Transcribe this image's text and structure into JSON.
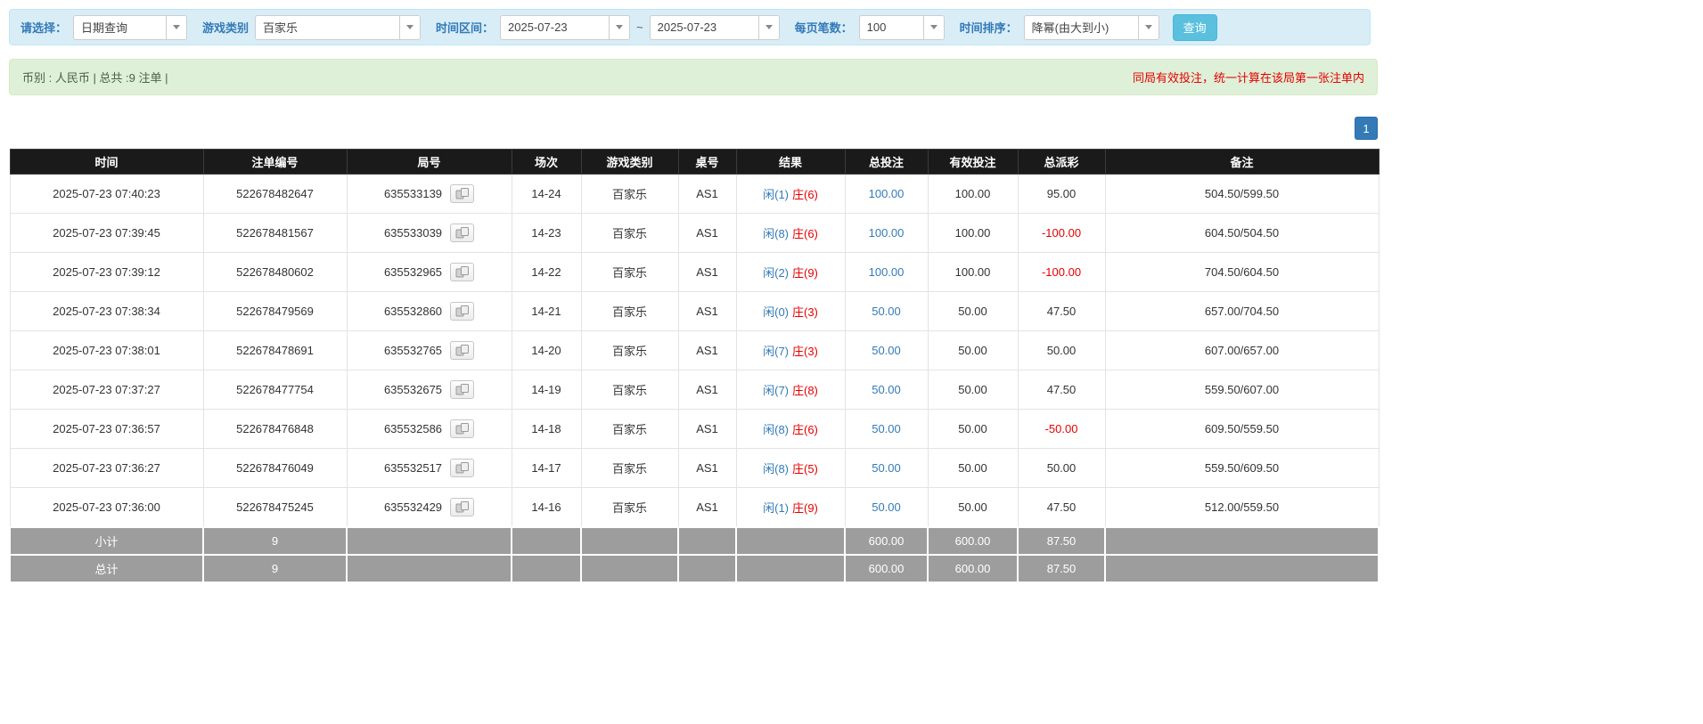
{
  "colors": {
    "accent": "#337ab7",
    "red": "#e60000",
    "search_button": "#5bc0de",
    "filter_bar_background": "#d9edf7",
    "summary_bar_background": "#dff0d8",
    "table_header_background": "#1a1a1a",
    "table_footer_background": "#9d9d9d"
  },
  "filter": {
    "select_label": "请选择：",
    "select_value": "日期查询",
    "game_type_label": "游戏类别",
    "game_type_value": "百家乐",
    "time_range_label": "时间区间：",
    "date_from": "2025-07-23",
    "tilde": "~",
    "date_to": "2025-07-23",
    "page_size_label": "每页笔数：",
    "page_size_value": "100",
    "sort_label": "时间排序：",
    "sort_value": "降幂(由大到小)",
    "search_button": "查询"
  },
  "summary": {
    "left": "币别 : 人民币 | 总共 :9 注单 |",
    "right": "同局有效投注，统一计算在该局第一张注单内"
  },
  "pagination": {
    "page": "1"
  },
  "table": {
    "headers": [
      "时间",
      "注单编号",
      "局号",
      "场次",
      "游戏类别",
      "桌号",
      "结果",
      "总投注",
      "有效投注",
      "总派彩",
      "备注"
    ],
    "rows": [
      {
        "time": "2025-07-23 07:40:23",
        "bet_id": "522678482647",
        "round": "635533139",
        "session": "14-24",
        "game": "百家乐",
        "table_no": "AS1",
        "result_player": "闲(1)",
        "result_banker": "庄(6)",
        "total_bet": "100.00",
        "valid_bet": "100.00",
        "payout": "95.00",
        "remark": "504.50/599.50"
      },
      {
        "time": "2025-07-23 07:39:45",
        "bet_id": "522678481567",
        "round": "635533039",
        "session": "14-23",
        "game": "百家乐",
        "table_no": "AS1",
        "result_player": "闲(8)",
        "result_banker": "庄(6)",
        "total_bet": "100.00",
        "valid_bet": "100.00",
        "payout": "-100.00",
        "remark": "604.50/504.50"
      },
      {
        "time": "2025-07-23 07:39:12",
        "bet_id": "522678480602",
        "round": "635532965",
        "session": "14-22",
        "game": "百家乐",
        "table_no": "AS1",
        "result_player": "闲(2)",
        "result_banker": "庄(9)",
        "total_bet": "100.00",
        "valid_bet": "100.00",
        "payout": "-100.00",
        "remark": "704.50/604.50"
      },
      {
        "time": "2025-07-23 07:38:34",
        "bet_id": "522678479569",
        "round": "635532860",
        "session": "14-21",
        "game": "百家乐",
        "table_no": "AS1",
        "result_player": "闲(0)",
        "result_banker": "庄(3)",
        "total_bet": "50.00",
        "valid_bet": "50.00",
        "payout": "47.50",
        "remark": "657.00/704.50"
      },
      {
        "time": "2025-07-23 07:38:01",
        "bet_id": "522678478691",
        "round": "635532765",
        "session": "14-20",
        "game": "百家乐",
        "table_no": "AS1",
        "result_player": "闲(7)",
        "result_banker": "庄(3)",
        "total_bet": "50.00",
        "valid_bet": "50.00",
        "payout": "50.00",
        "remark": "607.00/657.00"
      },
      {
        "time": "2025-07-23 07:37:27",
        "bet_id": "522678477754",
        "round": "635532675",
        "session": "14-19",
        "game": "百家乐",
        "table_no": "AS1",
        "result_player": "闲(7)",
        "result_banker": "庄(8)",
        "total_bet": "50.00",
        "valid_bet": "50.00",
        "payout": "47.50",
        "remark": "559.50/607.00"
      },
      {
        "time": "2025-07-23 07:36:57",
        "bet_id": "522678476848",
        "round": "635532586",
        "session": "14-18",
        "game": "百家乐",
        "table_no": "AS1",
        "result_player": "闲(8)",
        "result_banker": "庄(6)",
        "total_bet": "50.00",
        "valid_bet": "50.00",
        "payout": "-50.00",
        "remark": "609.50/559.50"
      },
      {
        "time": "2025-07-23 07:36:27",
        "bet_id": "522678476049",
        "round": "635532517",
        "session": "14-17",
        "game": "百家乐",
        "table_no": "AS1",
        "result_player": "闲(8)",
        "result_banker": "庄(5)",
        "total_bet": "50.00",
        "valid_bet": "50.00",
        "payout": "50.00",
        "remark": "559.50/609.50"
      },
      {
        "time": "2025-07-23 07:36:00",
        "bet_id": "522678475245",
        "round": "635532429",
        "session": "14-16",
        "game": "百家乐",
        "table_no": "AS1",
        "result_player": "闲(1)",
        "result_banker": "庄(9)",
        "total_bet": "50.00",
        "valid_bet": "50.00",
        "payout": "47.50",
        "remark": "512.00/559.50"
      }
    ],
    "subtotal": {
      "label": "小计",
      "count": "9",
      "total_bet": "600.00",
      "valid_bet": "600.00",
      "payout": "87.50"
    },
    "total": {
      "label": "总计",
      "count": "9",
      "total_bet": "600.00",
      "valid_bet": "600.00",
      "payout": "87.50"
    }
  }
}
